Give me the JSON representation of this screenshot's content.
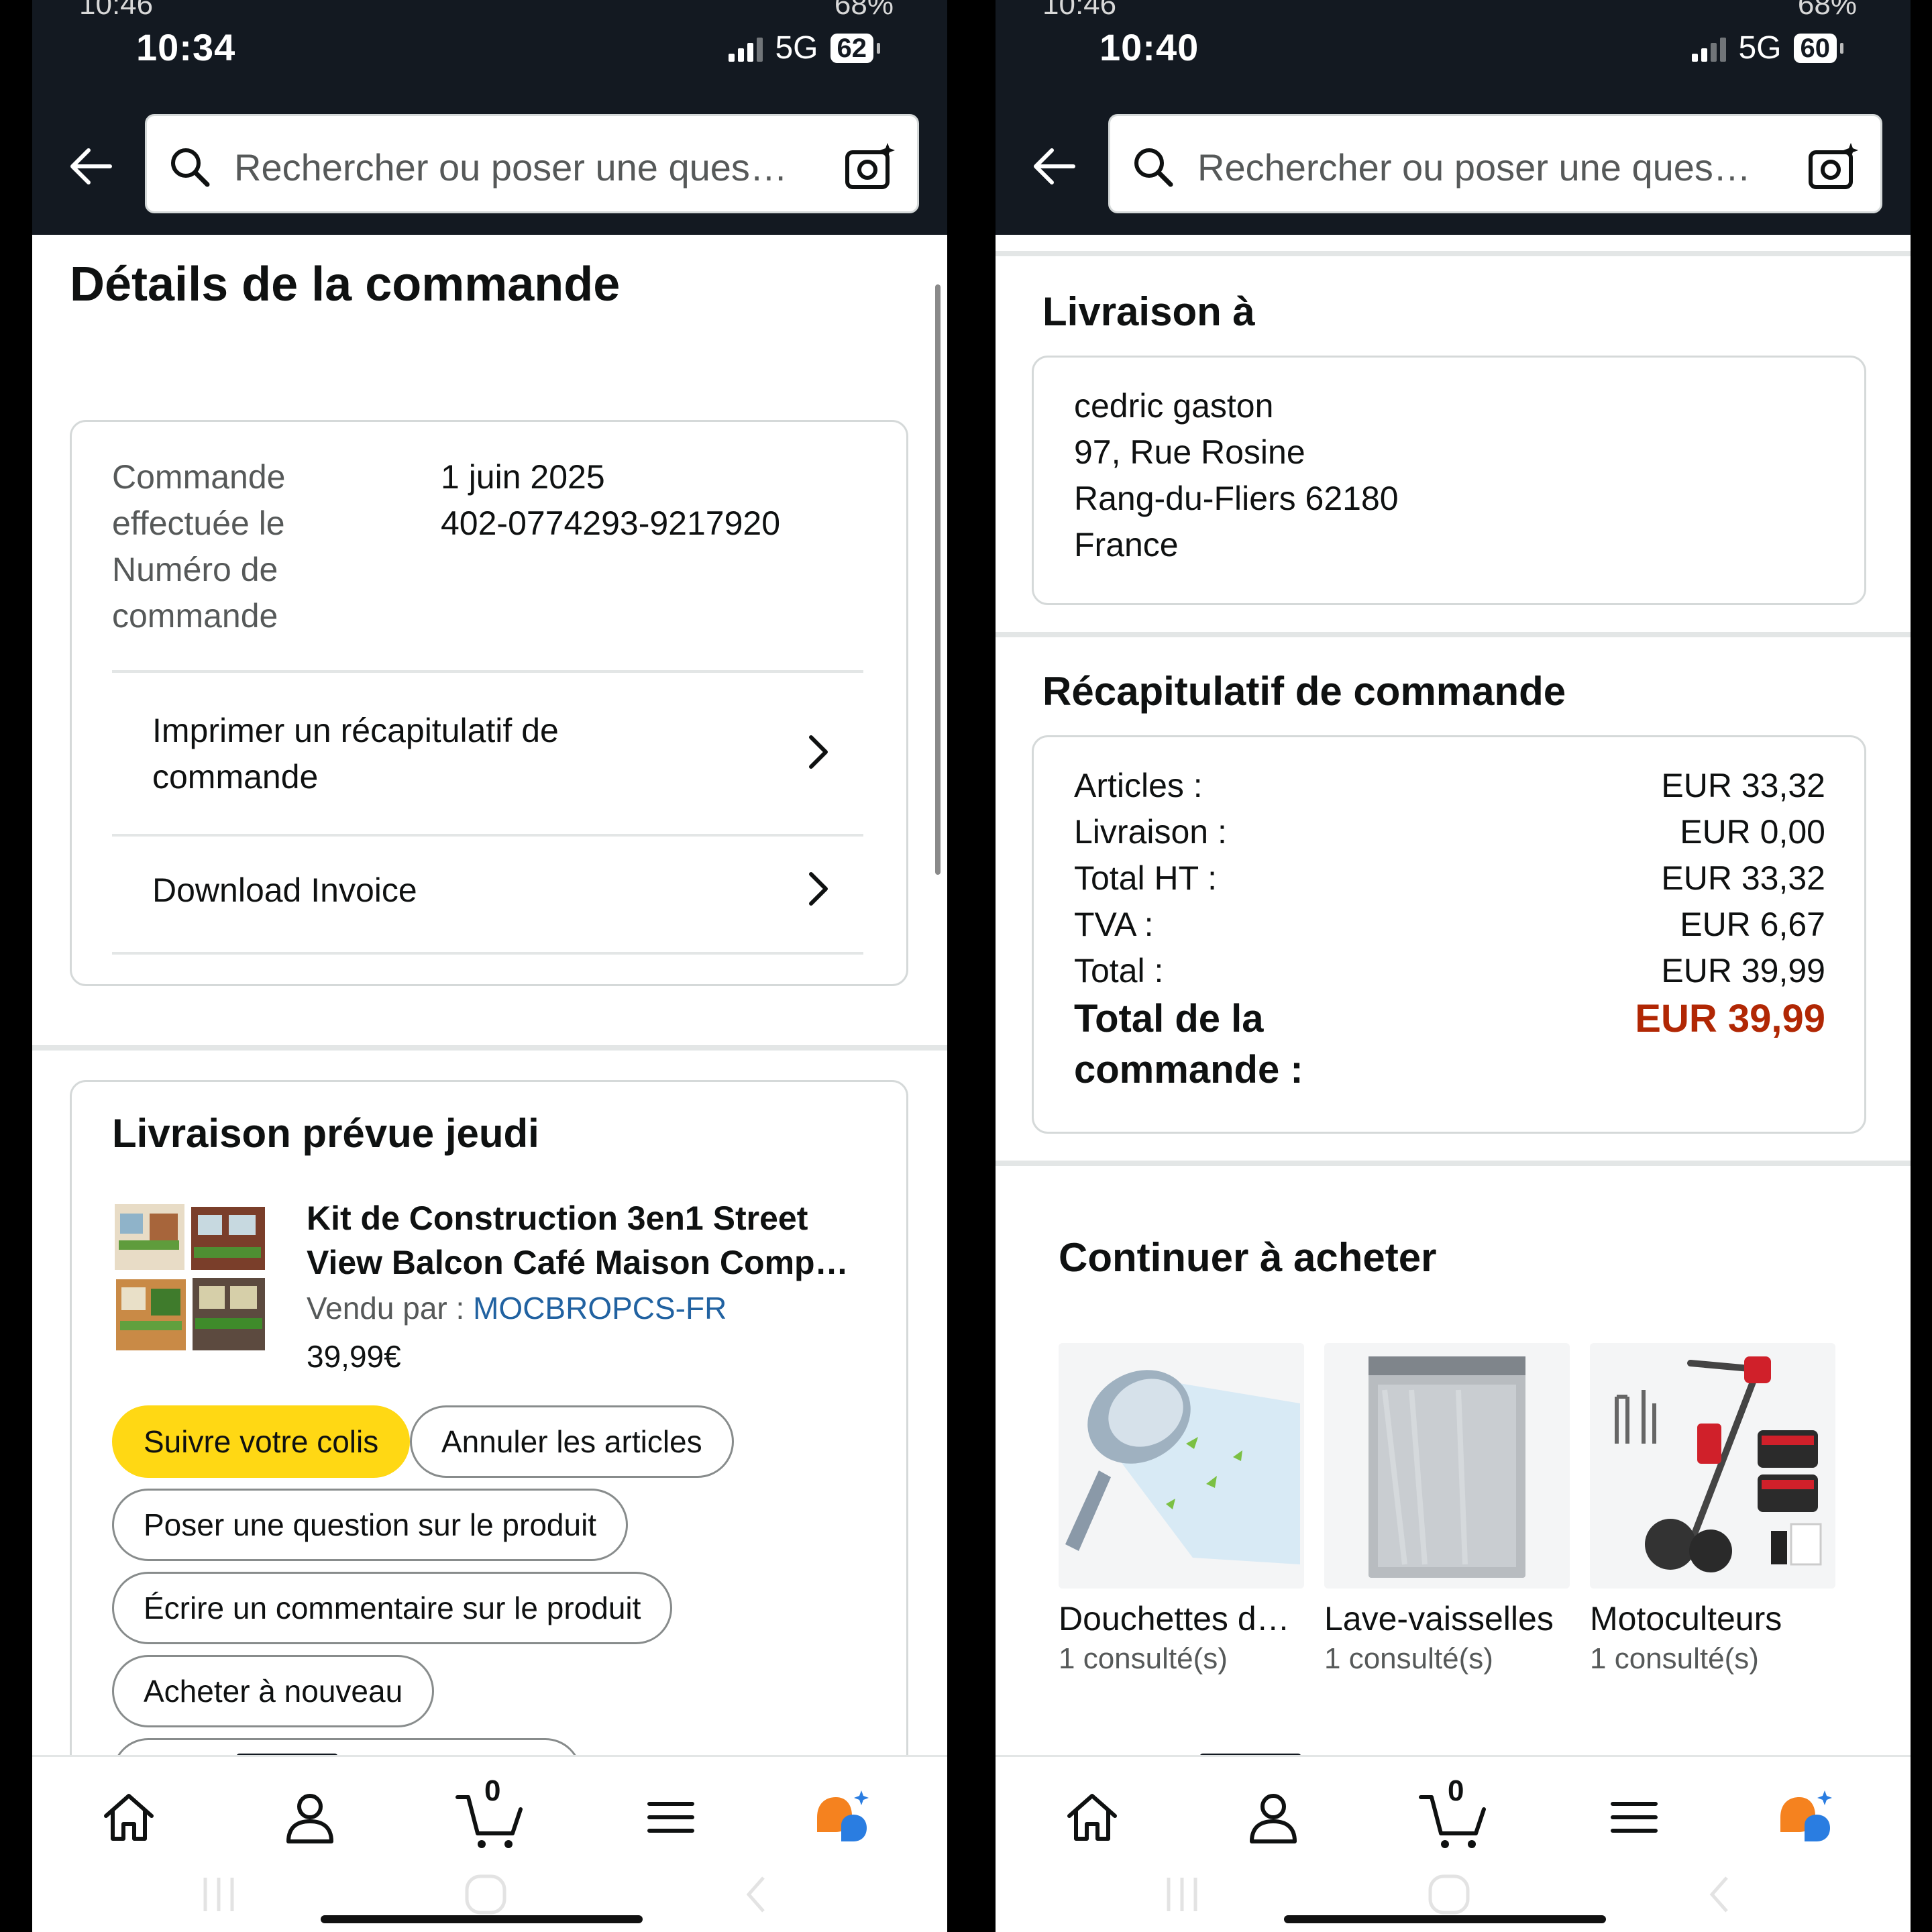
{
  "left": {
    "status": {
      "ghost_time": "10:46",
      "ghost_battery": "68%",
      "time": "10:34",
      "network": "5G",
      "battery": "62"
    },
    "search": {
      "placeholder": "Rechercher ou poser une ques…"
    },
    "page_title": "Détails de la commande",
    "order": {
      "date_label": "Commande effectuée le",
      "number_label": "Numéro de commande",
      "date_value": "1 juin 2025",
      "number_value": "402-0774293-9217920"
    },
    "links": {
      "print_summary": "Imprimer un récapitulatif de commande",
      "download_invoice": "Download Invoice"
    },
    "delivery": {
      "heading": "Livraison prévue jeudi",
      "product_title_line1": "Kit de Construction 3en1 Street",
      "product_title_line2": "View Balcon Café Maison Comp…",
      "sold_by_label": "Vendu par  : ",
      "seller": "MOCBROPCS-FR",
      "price": "39,99€"
    },
    "actions": {
      "track": "Suivre votre colis",
      "cancel": "Annuler les articles",
      "ask": "Poser une question sur le produit",
      "review": "Écrire un commentaire sur le produit",
      "buy_again": "Acheter à nouveau"
    },
    "tabbar": {
      "cart_count": "0"
    }
  },
  "right": {
    "status": {
      "ghost_time": "10:46",
      "ghost_battery": "68%",
      "time": "10:40",
      "network": "5G",
      "battery": "60"
    },
    "search": {
      "placeholder": "Rechercher ou poser une ques…"
    },
    "shipping": {
      "heading": "Livraison à",
      "name": "cedric gaston",
      "street": "97, Rue Rosine",
      "city": "Rang-du-Fliers 62180",
      "country": "France"
    },
    "summary": {
      "heading": "Récapitulatif de commande",
      "rows": [
        {
          "label": "Articles :",
          "value": "EUR 33,32"
        },
        {
          "label": "Livraison :",
          "value": "EUR 0,00"
        },
        {
          "label": "Total HT :",
          "value": "EUR 33,32"
        },
        {
          "label": "TVA :",
          "value": "EUR 6,67"
        },
        {
          "label": "Total :",
          "value": "EUR 39,99"
        }
      ],
      "grand_total_label": "Total de la commande :",
      "grand_total_value": "EUR 39,99"
    },
    "continue": {
      "heading": "Continuer à acheter",
      "tiles": [
        {
          "name": "Douchettes d…",
          "sub": "1 consulté(s)",
          "icon": "shower-head-image"
        },
        {
          "name": "Lave-vaisselles",
          "sub": "1 consulté(s)",
          "icon": "dishwasher-image"
        },
        {
          "name": "Motoculteurs",
          "sub": "1 consulté(s)",
          "icon": "tiller-image"
        }
      ]
    },
    "tabbar": {
      "cart_count": "0"
    }
  },
  "colors": {
    "header_bg": "#131921",
    "primary_button": "#ffd814",
    "price_red": "#b12704",
    "link_blue": "#2162a1"
  }
}
